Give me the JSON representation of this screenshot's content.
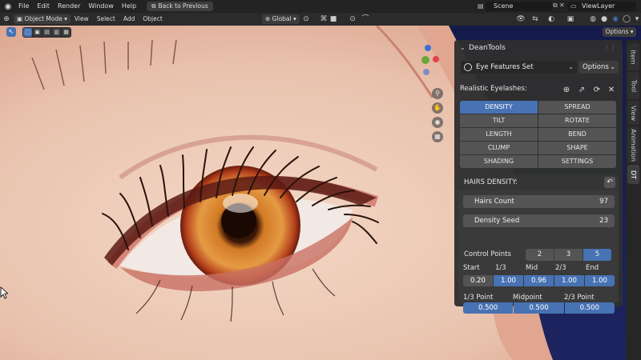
{
  "topbar": {
    "menus": [
      "File",
      "Edit",
      "Render",
      "Window",
      "Help"
    ],
    "back_label": "Back to Previous",
    "scene": "Scene",
    "view_layer": "ViewLayer"
  },
  "header": {
    "mode": "Object Mode",
    "menus": [
      "View",
      "Select",
      "Add",
      "Object"
    ],
    "transform": "Global",
    "options": "Options"
  },
  "side_tabs": [
    "Item",
    "Tool",
    "View",
    "Animation",
    "DT"
  ],
  "panel": {
    "title": "DeanTools",
    "preset": "Eye Features Set",
    "options": "Options",
    "section_label": "Realistic Eyelashes:",
    "grid": [
      [
        "DENSITY",
        "SPREAD"
      ],
      [
        "TILT",
        "ROTATE"
      ],
      [
        "LENGTH",
        "BEND"
      ],
      [
        "CLUMP",
        "SHAPE"
      ],
      [
        "SHADING",
        "SETTINGS"
      ]
    ],
    "sub_title": "HAIRS DENSITY:",
    "hairs_count_label": "Hairs Count",
    "hairs_count_value": "97",
    "density_seed_label": "Density Seed",
    "density_seed_value": "23",
    "control_points_label": "Control Points",
    "control_points": [
      "2",
      "3",
      "5"
    ],
    "point_labels": [
      "Start",
      "1/3",
      "Mid",
      "2/3",
      "End"
    ],
    "point_values": [
      "0.20",
      "1.00",
      "0.96",
      "1.00",
      "1.00"
    ],
    "point_pos_labels": [
      "1/3 Point",
      "Midpoint",
      "2/3 Point"
    ],
    "point_pos_values": [
      "0.500",
      "0.500",
      "0.500"
    ]
  },
  "colors": {
    "accent": "#4772b3",
    "panel_bg": "#303030",
    "button": "#545454"
  }
}
